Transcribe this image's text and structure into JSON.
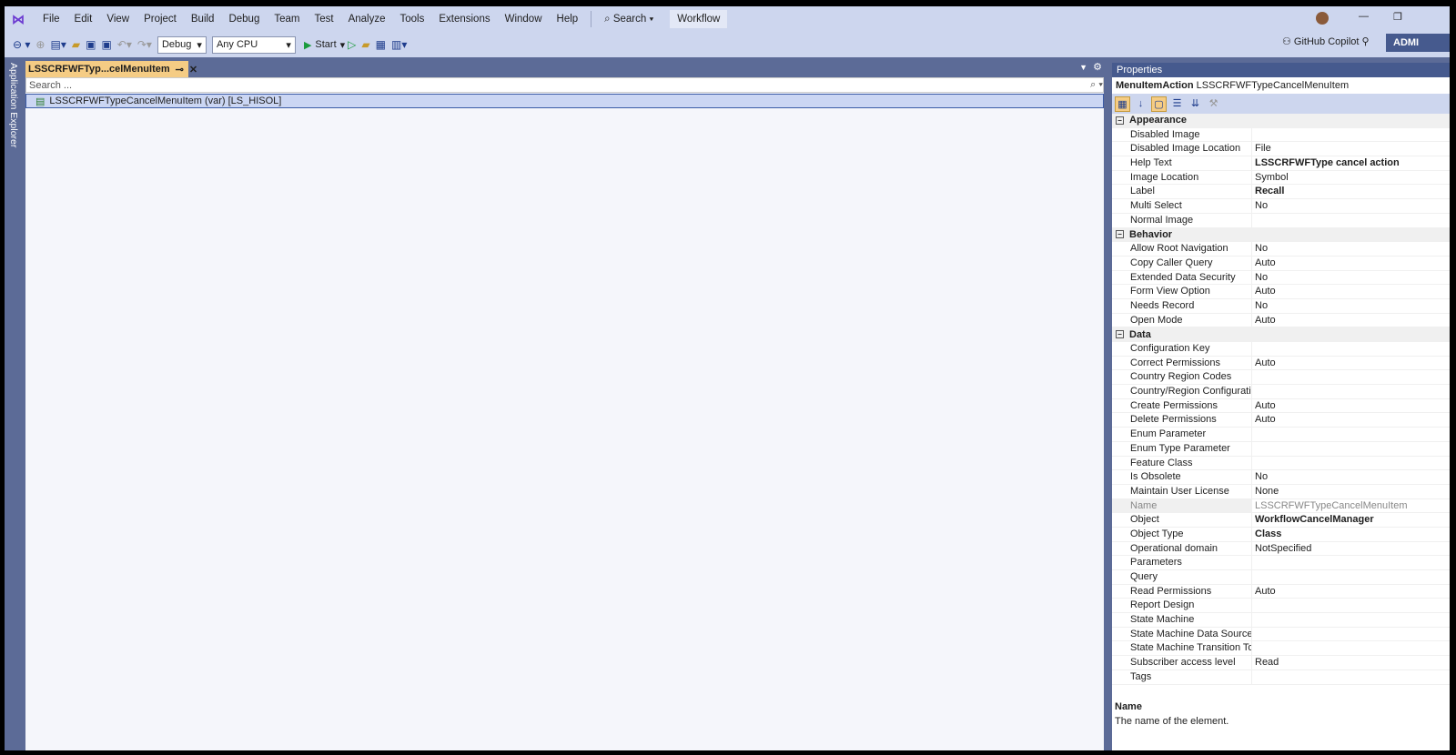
{
  "menu": [
    "File",
    "Edit",
    "View",
    "Project",
    "Build",
    "Debug",
    "Team",
    "Test",
    "Analyze",
    "Tools",
    "Extensions",
    "Window",
    "Help"
  ],
  "search_label": "Search",
  "workflow": "Workflow",
  "toolbar": {
    "config": "Debug",
    "platform": "Any CPU",
    "start": "Start"
  },
  "copilot": "GitHub Copilot",
  "user": "ADMI",
  "sidebar_label": "Application Explorer",
  "tab": {
    "title": "LSSCRFWFTyp...celMenuItem"
  },
  "doc": {
    "search_placeholder": "Search ...",
    "tree_item": "LSSCRFWFTypeCancelMenuItem (var) [LS_HISOL]"
  },
  "properties": {
    "title": "Properties",
    "object_type": "MenuItemAction",
    "object_name": "LSSCRFWFTypeCancelMenuItem",
    "categories": [
      {
        "name": "Appearance",
        "rows": [
          [
            "Disabled Image",
            ""
          ],
          [
            "Disabled Image Location",
            "File"
          ],
          [
            "Help Text",
            "LSSCRFWFType cancel action",
            "bold"
          ],
          [
            "Image Location",
            "Symbol"
          ],
          [
            "Label",
            "Recall",
            "bold"
          ],
          [
            "Multi Select",
            "No"
          ],
          [
            "Normal Image",
            ""
          ]
        ]
      },
      {
        "name": "Behavior",
        "rows": [
          [
            "Allow Root Navigation",
            "No"
          ],
          [
            "Copy Caller Query",
            "Auto"
          ],
          [
            "Extended Data Security",
            "No"
          ],
          [
            "Form View Option",
            "Auto"
          ],
          [
            "Needs Record",
            "No"
          ],
          [
            "Open Mode",
            "Auto"
          ]
        ]
      },
      {
        "name": "Data",
        "rows": [
          [
            "Configuration Key",
            ""
          ],
          [
            "Correct Permissions",
            "Auto"
          ],
          [
            "Country Region Codes",
            ""
          ],
          [
            "Country/Region Configuration Key",
            ""
          ],
          [
            "Create Permissions",
            "Auto"
          ],
          [
            "Delete Permissions",
            "Auto"
          ],
          [
            "Enum Parameter",
            ""
          ],
          [
            "Enum Type Parameter",
            ""
          ],
          [
            "Feature Class",
            ""
          ],
          [
            "Is Obsolete",
            "No"
          ],
          [
            "Maintain User License",
            "None"
          ],
          [
            "Name",
            "LSSCRFWFTypeCancelMenuItem",
            "gray"
          ],
          [
            "Object",
            "WorkflowCancelManager",
            "bold"
          ],
          [
            "Object Type",
            "Class",
            "bold"
          ],
          [
            "Operational domain",
            "NotSpecified"
          ],
          [
            "Parameters",
            ""
          ],
          [
            "Query",
            ""
          ],
          [
            "Read Permissions",
            "Auto"
          ],
          [
            "Report Design",
            ""
          ],
          [
            "State Machine",
            ""
          ],
          [
            "State Machine Data Source",
            ""
          ],
          [
            "State Machine Transition To",
            ""
          ],
          [
            "Subscriber access level",
            "Read"
          ],
          [
            "Tags",
            ""
          ]
        ]
      }
    ],
    "desc_title": "Name",
    "desc_text": "The name of the element."
  }
}
